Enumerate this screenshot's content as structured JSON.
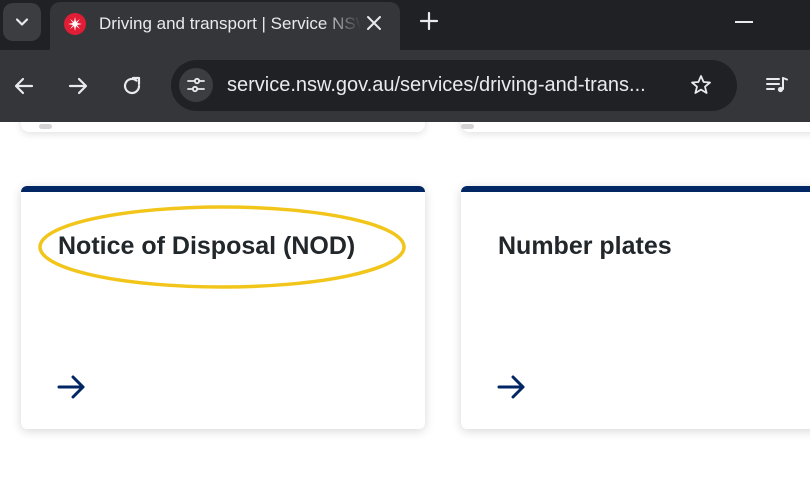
{
  "browser": {
    "tab_title": "Driving and transport | Service NSW",
    "url": "service.nsw.gov.au/services/driving-and-trans...",
    "icons": [
      "tab-search-icon",
      "nsw-favicon-icon",
      "close-icon",
      "new-tab-icon",
      "minimize-icon",
      "back-icon",
      "forward-icon",
      "reload-icon",
      "site-info-icon",
      "bookmark-star-icon",
      "media-controls-icon"
    ]
  },
  "page": {
    "cards": [
      {
        "title": "Notice of Disposal (NOD)",
        "icon": "arrow-right-icon",
        "highlighted": true
      },
      {
        "title": "Number plates",
        "icon": "arrow-right-icon",
        "highlighted": false
      }
    ]
  },
  "colors": {
    "card_accent": "#002664",
    "highlight": "#f2c51b",
    "favicon": "#e11d35"
  }
}
